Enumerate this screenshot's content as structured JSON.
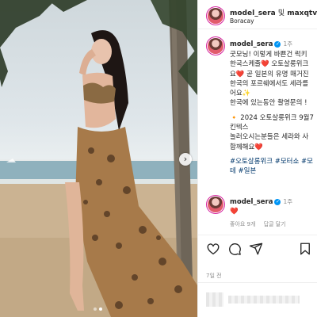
{
  "post": {
    "header": {
      "author": "model_sera",
      "conjunction": "및",
      "collaborator": "maxqtv",
      "location": "Boracay"
    },
    "caption": {
      "username": "model_sera",
      "time": "1주",
      "lines": [
        "굿모닝! 이렇게 바쁜건 럭키",
        "한국스케줄❤️ 오토살롱위크",
        "요❤️ 곧 일본의 유명 매거진",
        "한국의 포르쉐에서도 세라를",
        "어요✨",
        "한국에 있는동안 촬영문의 !"
      ],
      "event_lines": [
        "🔸 2024 오토살롱위크 9월7",
        "킨텍스",
        "놀러오시는분들은 세라와 사",
        "함께해요❤️"
      ],
      "hashtag_lines": [
        "#오토살롱위크 #모터쇼 #모",
        "테 #일본"
      ]
    },
    "comment": {
      "username": "model_sera",
      "time": "1주",
      "text": "❤️",
      "likes": "좋아요 9개",
      "reply": "답글 달기"
    },
    "time_ago": "7일 전"
  },
  "icons": {
    "heart": "heart-icon",
    "comment": "comment-icon",
    "share": "share-icon",
    "bookmark": "bookmark-icon",
    "next": "chevron-right-icon",
    "verified": "verified-badge-icon"
  },
  "colors": {
    "verified": "#0095f6",
    "link": "#00376b",
    "muted": "#8e8e8e",
    "like_red": "#ed4956"
  }
}
